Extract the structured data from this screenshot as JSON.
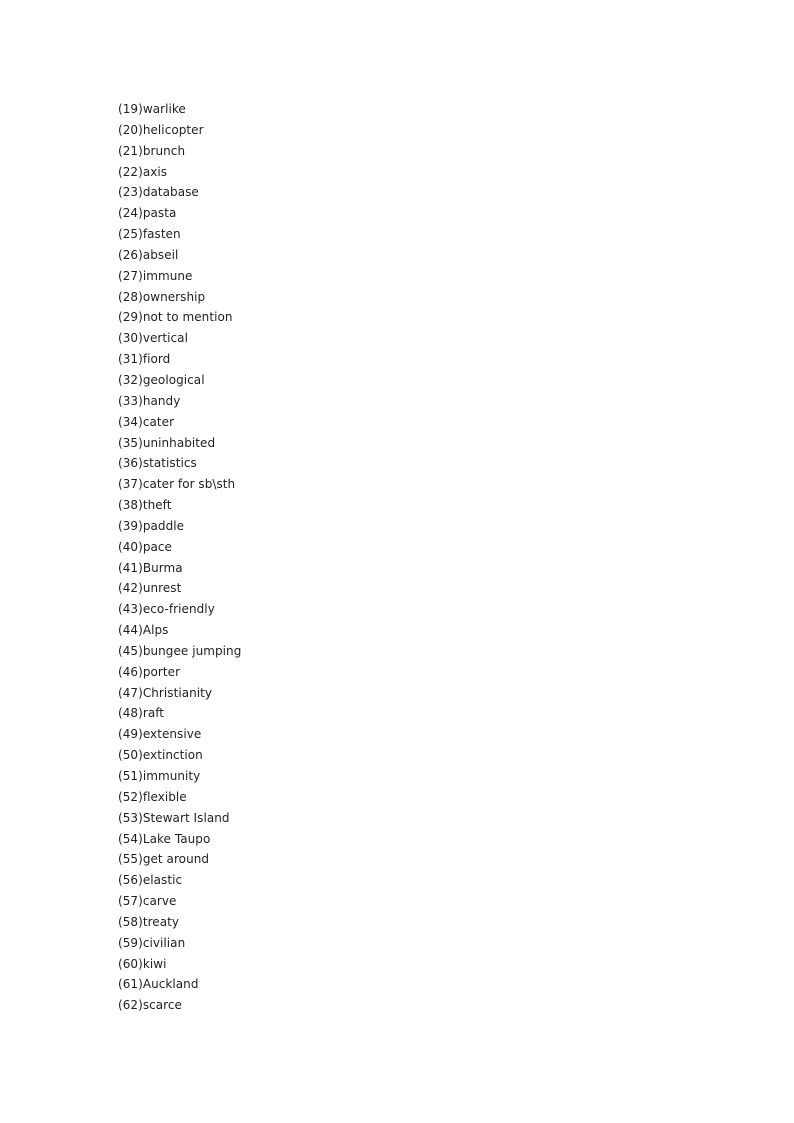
{
  "document": {
    "page_background": "#ffffff",
    "text_color": "#231f20",
    "list_label": "numbered-vocabulary-list",
    "items": [
      {
        "number": "(19)",
        "term": "warlike",
        "text": "(19)warlike"
      },
      {
        "number": "(20)",
        "term": "helicopter",
        "text": "(20)helicopter"
      },
      {
        "number": "(21)",
        "term": "brunch",
        "text": "(21)brunch"
      },
      {
        "number": "(22)",
        "term": "axis",
        "text": "(22)axis"
      },
      {
        "number": "(23)",
        "term": "database",
        "text": "(23)database"
      },
      {
        "number": "(24)",
        "term": "pasta",
        "text": "(24)pasta"
      },
      {
        "number": "(25)",
        "term": "fasten",
        "text": "(25)fasten"
      },
      {
        "number": "(26)",
        "term": "abseil",
        "text": "(26)abseil"
      },
      {
        "number": "(27)",
        "term": "immune",
        "text": "(27)immune"
      },
      {
        "number": "(28)",
        "term": "ownership",
        "text": "(28)ownership"
      },
      {
        "number": "(29)",
        "term": "not to mention",
        "text": "(29)not to mention"
      },
      {
        "number": "(30)",
        "term": "vertical",
        "text": "(30)vertical"
      },
      {
        "number": "(31)",
        "term": "fiord",
        "text": "(31)fiord"
      },
      {
        "number": "(32)",
        "term": "geological",
        "text": "(32)geological"
      },
      {
        "number": "(33)",
        "term": "handy",
        "text": "(33)handy"
      },
      {
        "number": "(34)",
        "term": "cater",
        "text": "(34)cater"
      },
      {
        "number": "(35)",
        "term": "uninhabited",
        "text": "(35)uninhabited"
      },
      {
        "number": "(36)",
        "term": "statistics",
        "text": "(36)statistics"
      },
      {
        "number": "(37)",
        "term": "cater for sb\\sth",
        "text": "(37)cater for sb\\sth"
      },
      {
        "number": "(38)",
        "term": "theft",
        "text": "(38)theft"
      },
      {
        "number": "(39)",
        "term": "paddle",
        "text": "(39)paddle"
      },
      {
        "number": "(40)",
        "term": "pace",
        "text": "(40)pace"
      },
      {
        "number": "(41)",
        "term": "Burma",
        "text": "(41)Burma"
      },
      {
        "number": "(42)",
        "term": "unrest",
        "text": "(42)unrest"
      },
      {
        "number": "(43)",
        "term": "eco-friendly",
        "text": "(43)eco-friendly"
      },
      {
        "number": "(44)",
        "term": "Alps",
        "text": "(44)Alps"
      },
      {
        "number": "(45)",
        "term": "bungee jumping",
        "text": "(45)bungee jumping"
      },
      {
        "number": "(46)",
        "term": "porter",
        "text": "(46)porter"
      },
      {
        "number": "(47)",
        "term": "Christianity",
        "text": "(47)Christianity"
      },
      {
        "number": "(48)",
        "term": "raft",
        "text": "(48)raft"
      },
      {
        "number": "(49)",
        "term": "extensive",
        "text": "(49)extensive"
      },
      {
        "number": "(50)",
        "term": "extinction",
        "text": "(50)extinction"
      },
      {
        "number": "(51)",
        "term": "immunity",
        "text": "(51)immunity"
      },
      {
        "number": "(52)",
        "term": "flexible",
        "text": "(52)flexible"
      },
      {
        "number": "(53)",
        "term": "Stewart Island",
        "text": "(53)Stewart Island"
      },
      {
        "number": "(54)",
        "term": "Lake Taupo",
        "text": "(54)Lake Taupo"
      },
      {
        "number": "(55)",
        "term": "get around",
        "text": "(55)get around"
      },
      {
        "number": "(56)",
        "term": "elastic",
        "text": "(56)elastic"
      },
      {
        "number": "(57)",
        "term": "carve",
        "text": "(57)carve"
      },
      {
        "number": "(58)",
        "term": "treaty",
        "text": "(58)treaty"
      },
      {
        "number": "(59)",
        "term": "civilian",
        "text": "(59)civilian"
      },
      {
        "number": "(60)",
        "term": "kiwi",
        "text": "(60)kiwi"
      },
      {
        "number": "(61)",
        "term": "Auckland",
        "text": "(61)Auckland"
      },
      {
        "number": "(62)",
        "term": "scarce",
        "text": "(62)scarce"
      }
    ]
  }
}
